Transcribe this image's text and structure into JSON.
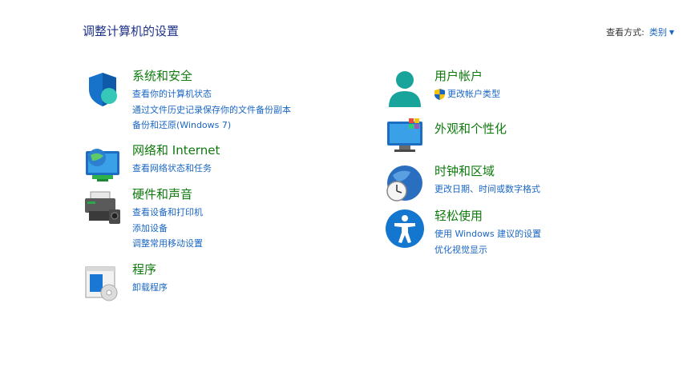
{
  "header": {
    "title": "调整计算机的设置",
    "view_by_label": "查看方式:",
    "view_by_value": "类别"
  },
  "categories": {
    "system": {
      "title": "系统和安全",
      "links": [
        "查看你的计算机状态",
        "通过文件历史记录保存你的文件备份副本",
        "备份和还原(Windows 7)"
      ]
    },
    "network": {
      "title": "网络和 Internet",
      "links": [
        "查看网络状态和任务"
      ]
    },
    "hardware": {
      "title": "硬件和声音",
      "links": [
        "查看设备和打印机",
        "添加设备",
        "调整常用移动设置"
      ]
    },
    "programs": {
      "title": "程序",
      "links": [
        "卸载程序"
      ]
    },
    "user": {
      "title": "用户帐户",
      "links": [
        "更改帐户类型"
      ]
    },
    "appearance": {
      "title": "外观和个性化",
      "links": []
    },
    "clock": {
      "title": "时钟和区域",
      "links": [
        "更改日期、时间或数字格式"
      ]
    },
    "ease": {
      "title": "轻松使用",
      "links": [
        "使用 Windows 建议的设置",
        "优化视觉显示"
      ]
    }
  },
  "icons": {
    "system": "shield-icon",
    "network": "network-globe-icon",
    "hardware": "printer-icon",
    "programs": "programs-box-icon",
    "user": "user-icon",
    "appearance": "monitor-palette-icon",
    "clock": "globe-clock-icon",
    "ease": "accessibility-icon"
  },
  "colors": {
    "category_title": "#0e7a0d",
    "link": "#1a66c4",
    "page_title": "#1e3287"
  }
}
